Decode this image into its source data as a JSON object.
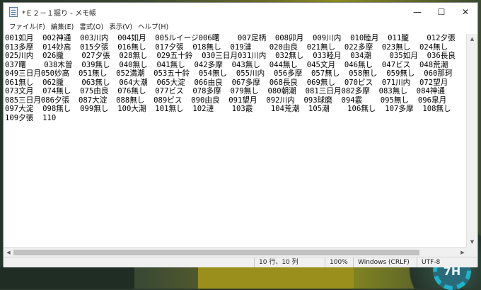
{
  "window": {
    "title": "*Ｅ２－１掘り - メモ帳",
    "controls": {
      "minimize": "—",
      "maximize": "☐",
      "close": "✕"
    }
  },
  "menu": [
    {
      "label": "ファイル(F)"
    },
    {
      "label": "編集(E)"
    },
    {
      "label": "書式(O)"
    },
    {
      "label": "表示(V)"
    },
    {
      "label": "ヘルプ(H)"
    }
  ],
  "editor": {
    "lines": [
      "001如月  002神通  003川内  004如月  005ルイージ006曙    007足柄  008卯月  009川内  010睦月  011朧    012夕張",
      "013多摩  014妙高  015夕張  016無し  017夕張  018無し  019漣    020由良  021無し  022多摩  023無し  024無し",
      "025川内  026朧    027夕張  028無し  029五十鈴  030三日月031川内  032無し  033睦月  034潮    035如月  036長良",
      "037曙    038木曽  039無し  040無し  041無し  042多摩  043無し  044無し  045文月  046無し  047ビス  048荒潮",
      "049三日月050妙高  051無し  052満潮  053五十鈴  054無し  055川内  056多摩  057無し  058無し  059無し  060那珂",
      "061無し  062朧    063無し  064大潮  065大淀  066由良  067多摩  068長良  069無し  070ビス  071川内  072望月",
      "073文月  074無し  075由良  076無し  077ビス  078多摩  079無し  080朝潮  081三日月082多摩  083無し  084神通",
      "085三日月086夕張  087大淀  088無し  089ビス  090由良  091望月  092川内  093球磨  094霰    095無し  096皐月",
      "097大淀  098無し  099無し  100大潮  101無し  102漣    103霰    104荒潮  105潮    106無し  107多摩  108無し",
      "109夕張  110"
    ]
  },
  "status": {
    "position": "10 行、10 列",
    "zoom": "100%",
    "line_ending": "Windows (CRLF)",
    "encoding": "UTF-8"
  },
  "desktop": {
    "gear_label": "7H"
  }
}
